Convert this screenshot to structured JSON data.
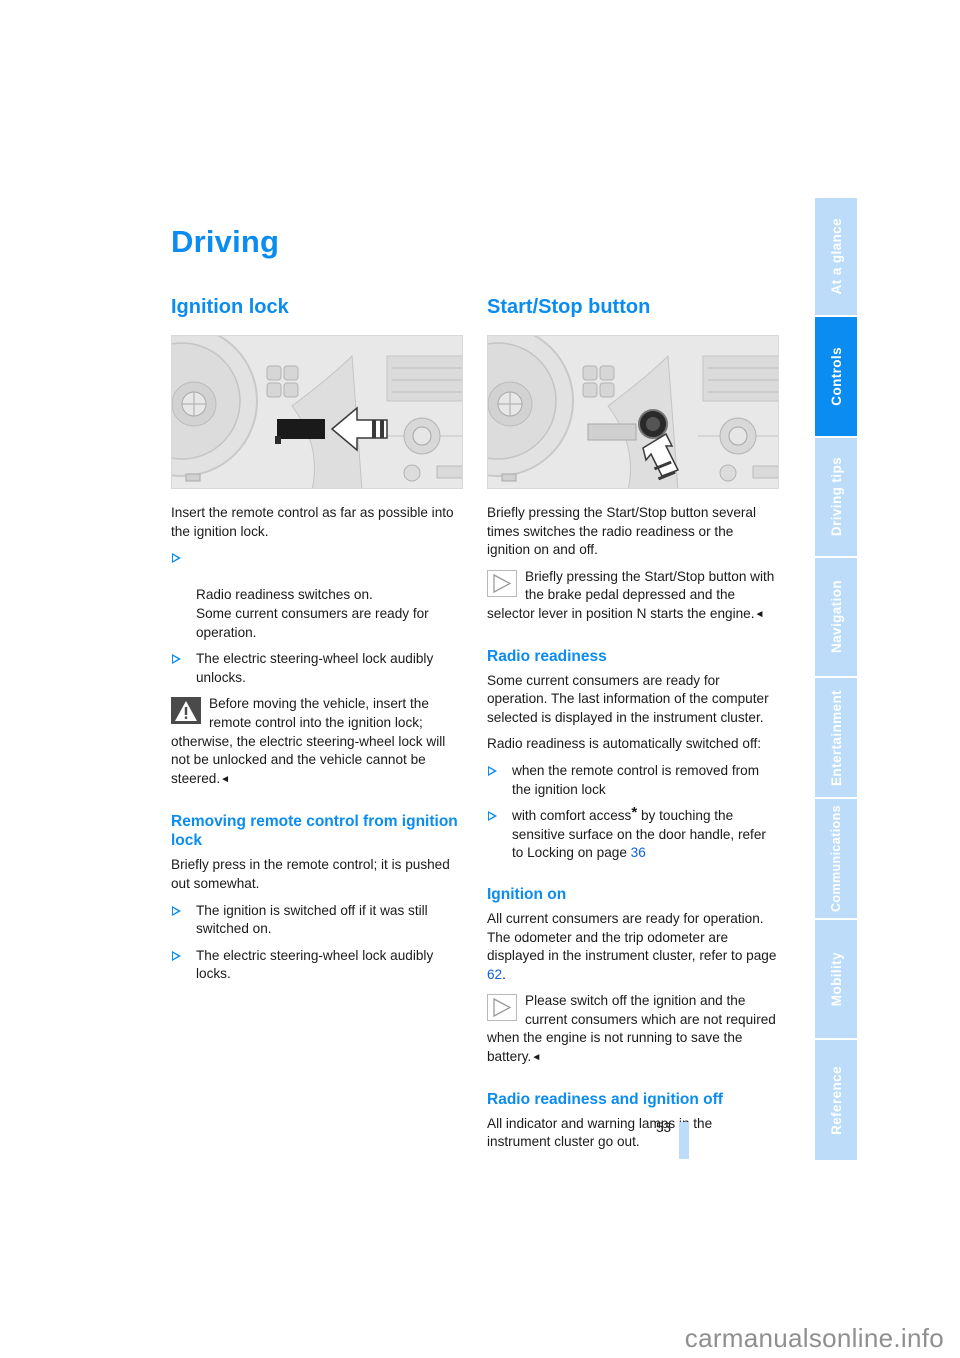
{
  "page": {
    "title": "Driving",
    "page_number": "53",
    "watermark": "carmanualsonline.info"
  },
  "side_tabs": [
    {
      "label": "At a glance",
      "active": false
    },
    {
      "label": "Controls",
      "active": true
    },
    {
      "label": "Driving tips",
      "active": false
    },
    {
      "label": "Navigation",
      "active": false
    },
    {
      "label": "Entertainment",
      "active": false
    },
    {
      "label": "Communications",
      "active": false
    },
    {
      "label": "Mobility",
      "active": false
    },
    {
      "label": "Reference",
      "active": false
    }
  ],
  "left": {
    "heading": "Ignition lock",
    "figure_alt": "Remote control being inserted into ignition lock",
    "intro": "Insert the remote control as far as possible into the ignition lock.",
    "bullets1": [
      "Radio readiness switches on.\nSome current consumers are ready for operation.",
      "The electric steering-wheel lock audibly unlocks."
    ],
    "warning": {
      "icon": "warning-triangle-icon",
      "text": "Before moving the vehicle, insert the remote control into the ignition lock; otherwise, the electric steering-wheel lock will not be unlocked and the vehicle cannot be steered."
    },
    "subheading": "Removing remote control from ignition lock",
    "sub_text": "Briefly press in the remote control; it is pushed out somewhat.",
    "bullets2": [
      "The ignition is switched off if it was still switched on.",
      "The electric steering-wheel lock audibly locks."
    ]
  },
  "right": {
    "heading": "Start/Stop button",
    "figure_alt": "Finger pressing Start/Stop button",
    "intro": "Briefly pressing the Start/Stop button several times switches the radio readiness or the ignition on and off.",
    "note1": {
      "icon": "note-arrow-icon",
      "text": "Briefly pressing the Start/Stop button with the brake pedal depressed and the selector lever in position N starts the engine."
    },
    "radio": {
      "heading": "Radio readiness",
      "text1": "Some current consumers are ready for operation. The last information of the computer selected is displayed in the instrument cluster.",
      "text2": "Radio readiness is automatically switched off:",
      "bullet1": "when the remote control is removed from the ignition lock",
      "bullet2_pre": "with comfort access",
      "bullet2_star": "*",
      "bullet2_post": " by touching the sensitive surface on the door handle, refer to Locking on page ",
      "bullet2_link": "36"
    },
    "ignition_on": {
      "heading": "Ignition on",
      "text_pre": "All current consumers are ready for operation. The odometer and the trip odometer are displayed in the instrument cluster, refer to page ",
      "text_link": "62",
      "text_post": "."
    },
    "note2": {
      "icon": "note-arrow-icon",
      "text": "Please switch off the ignition and the current consumers which are not required when the engine is not running to save the battery."
    },
    "off": {
      "heading": "Radio readiness and ignition off",
      "text": "All indicator and warning lamps in the instrument cluster go out."
    },
    "end_mark": "◄"
  }
}
